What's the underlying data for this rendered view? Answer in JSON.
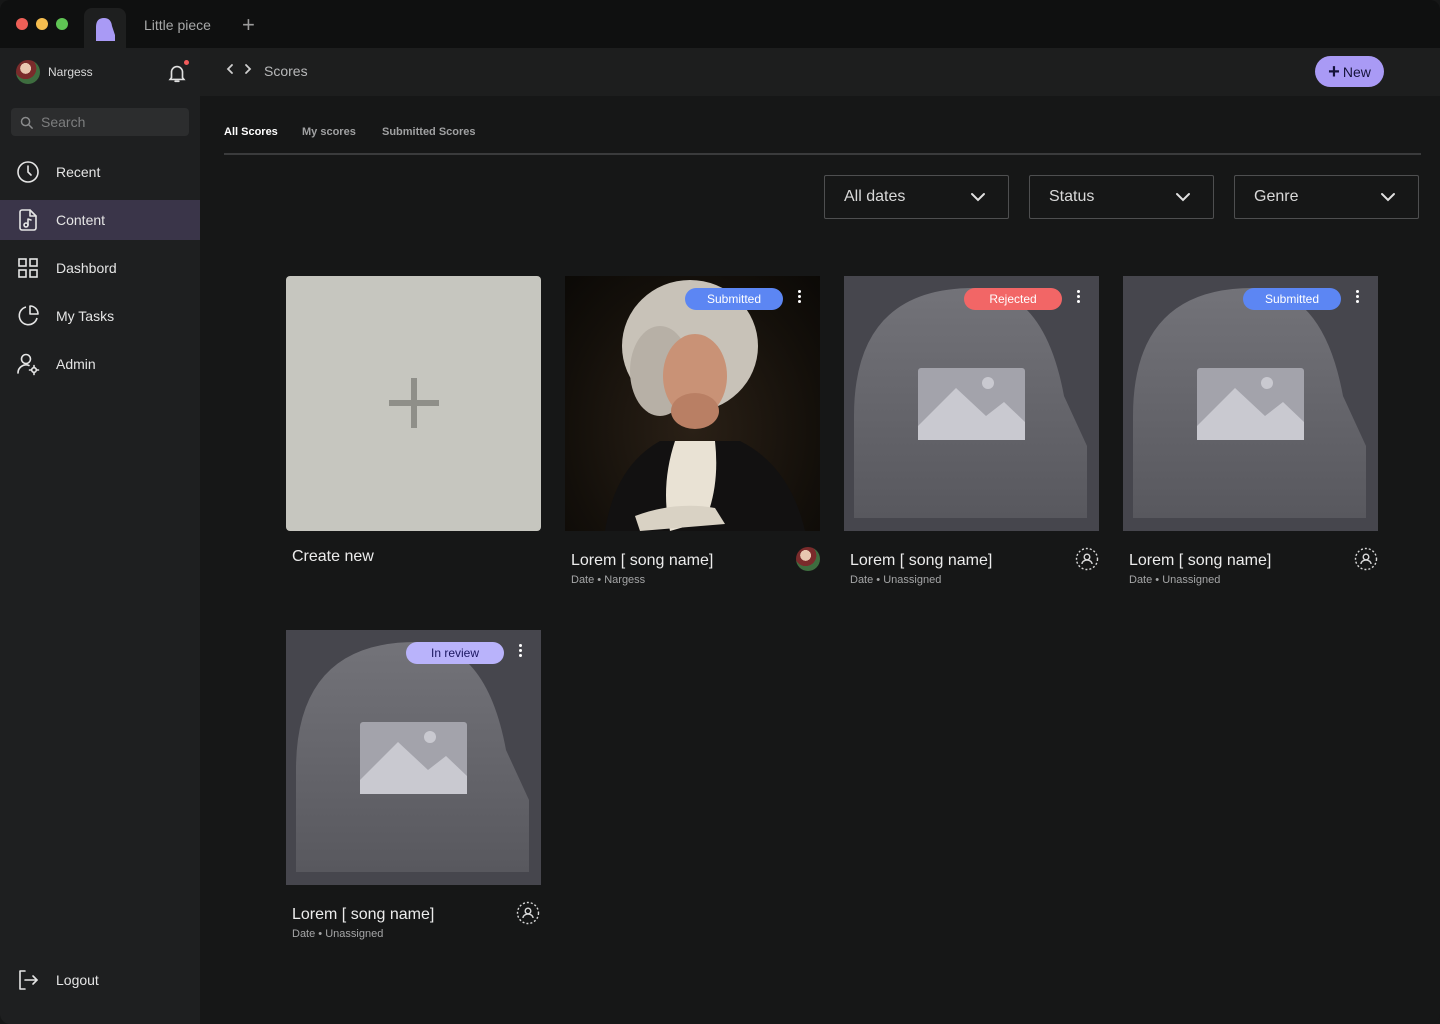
{
  "titlebar": {
    "document_tab": "Little piece",
    "new_tab_label": "+"
  },
  "sidebar": {
    "user_name": "Nargess",
    "search_placeholder": "Search",
    "items": [
      {
        "label": "Recent",
        "icon": "clock-icon"
      },
      {
        "label": "Content",
        "icon": "music-file-icon",
        "active": true
      },
      {
        "label": "Dashbord",
        "icon": "grid-icon"
      },
      {
        "label": "My Tasks",
        "icon": "pie-chart-icon"
      },
      {
        "label": "Admin",
        "icon": "user-settings-icon"
      }
    ],
    "logout_label": "Logout"
  },
  "header": {
    "breadcrumb": "Scores",
    "new_button_label": "New"
  },
  "tabs": [
    {
      "label": "All Scores",
      "active": true
    },
    {
      "label": "My scores"
    },
    {
      "label": "Submitted Scores"
    }
  ],
  "filters": [
    {
      "label": "All dates"
    },
    {
      "label": "Status"
    },
    {
      "label": "Genre"
    }
  ],
  "create_card": {
    "label": "Create new"
  },
  "scores": [
    {
      "title": "Lorem [ song name]",
      "date": "Date",
      "assignee": "Nargess",
      "status": "Submitted",
      "thumbnail": "portrait"
    },
    {
      "title": "Lorem [ song name]",
      "date": "Date",
      "assignee": "Unassigned",
      "status": "Rejected",
      "thumbnail": "placeholder"
    },
    {
      "title": "Lorem [ song name]",
      "date": "Date",
      "assignee": "Unassigned",
      "status": "Submitted",
      "thumbnail": "placeholder"
    },
    {
      "title": "Lorem [ song name]",
      "date": "Date",
      "assignee": "Unassigned",
      "status": "In review",
      "thumbnail": "placeholder"
    }
  ],
  "colors": {
    "accent": "#a99af5",
    "submitted": "#5c86f3",
    "rejected": "#f26666",
    "in_review": "#b9b3fb",
    "active_nav": "#3a3549"
  }
}
